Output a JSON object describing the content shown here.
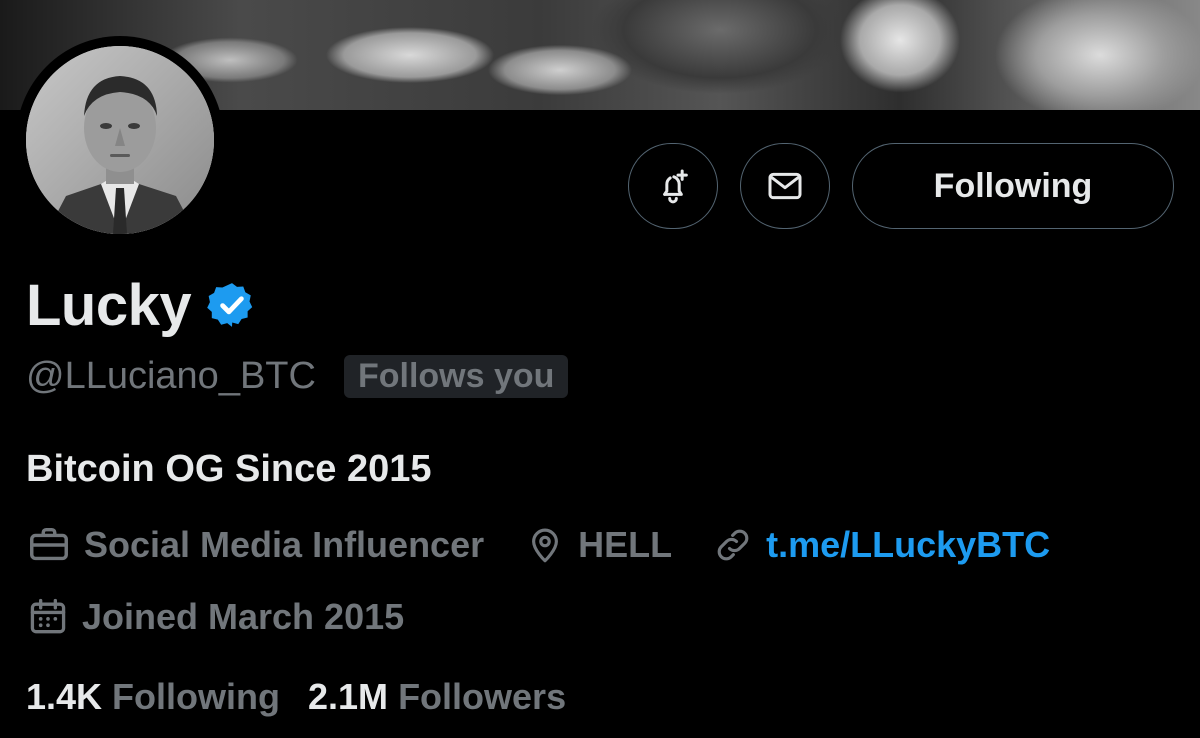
{
  "profile": {
    "name": "Lucky",
    "handle": "@LLuciano_BTC",
    "follows_you": "Follows you",
    "bio": "Bitcoin OG Since 2015",
    "category": "Social Media Influencer",
    "location": "HELL",
    "link": "t.me/LLuckyBTC",
    "joined": "Joined March 2015"
  },
  "actions": {
    "notify_icon": "bell-plus-icon",
    "message_icon": "envelope-icon",
    "follow_label": "Following"
  },
  "stats": {
    "following_count": "1.4K",
    "following_label": "Following",
    "followers_count": "2.1M",
    "followers_label": "Followers"
  },
  "colors": {
    "background": "#000000",
    "accent": "#1d9bf0",
    "muted": "#71767b",
    "text": "#e7e9ea",
    "verified_badge": "#1d9bf0"
  }
}
